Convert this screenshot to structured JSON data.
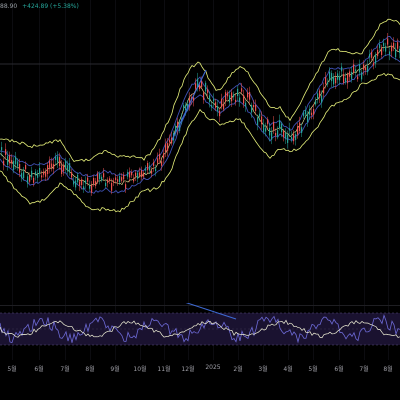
{
  "legend": {
    "price": "88.90",
    "change": "+424.89 (+5.38%)"
  },
  "colors": {
    "background": "#000000",
    "candle_up": "#26a69a",
    "candle_down": "#ef5350",
    "band_outer": "#e6f07a",
    "band_mid": "#3f51b5",
    "ma_fast": "#f0f0a0",
    "rsi_line": "#6d6ad6",
    "rsi_signal": "#f2f2d8",
    "rsi_zone": "#1a1230",
    "trendline": "#3f6bd6"
  },
  "x_axis": {
    "ticks": [
      "5월",
      "6월",
      "7월",
      "8월",
      "9월",
      "10월",
      "11월",
      "12월",
      "2025",
      "2월",
      "3월",
      "4월",
      "5월",
      "6월",
      "7월",
      "8월"
    ]
  },
  "chart_data": [
    {
      "type": "line",
      "name": "price",
      "x": [
        "5월",
        "6월",
        "7월",
        "8월",
        "9월",
        "10월",
        "11월",
        "12월",
        "2025",
        "2월",
        "3월",
        "4월",
        "5월",
        "6월",
        "7월",
        "8월"
      ],
      "series": [
        {
          "values": [
            165,
            178,
            170,
            185,
            180,
            175,
            160,
            95,
            88,
            100,
            130,
            125,
            105,
            70,
            55,
            45
          ]
        }
      ]
    },
    {
      "type": "line",
      "name": "rsi",
      "x": [
        "5월",
        "6월",
        "7월",
        "8월",
        "9월",
        "10월",
        "11월",
        "12월",
        "2025",
        "2월",
        "3월",
        "4월",
        "5월",
        "6월",
        "7월",
        "8월"
      ],
      "series": [
        {
          "values": [
            45,
            38,
            52,
            48,
            42,
            56,
            62,
            68,
            55,
            40,
            50,
            46,
            60,
            58,
            52,
            64
          ]
        }
      ]
    }
  ]
}
